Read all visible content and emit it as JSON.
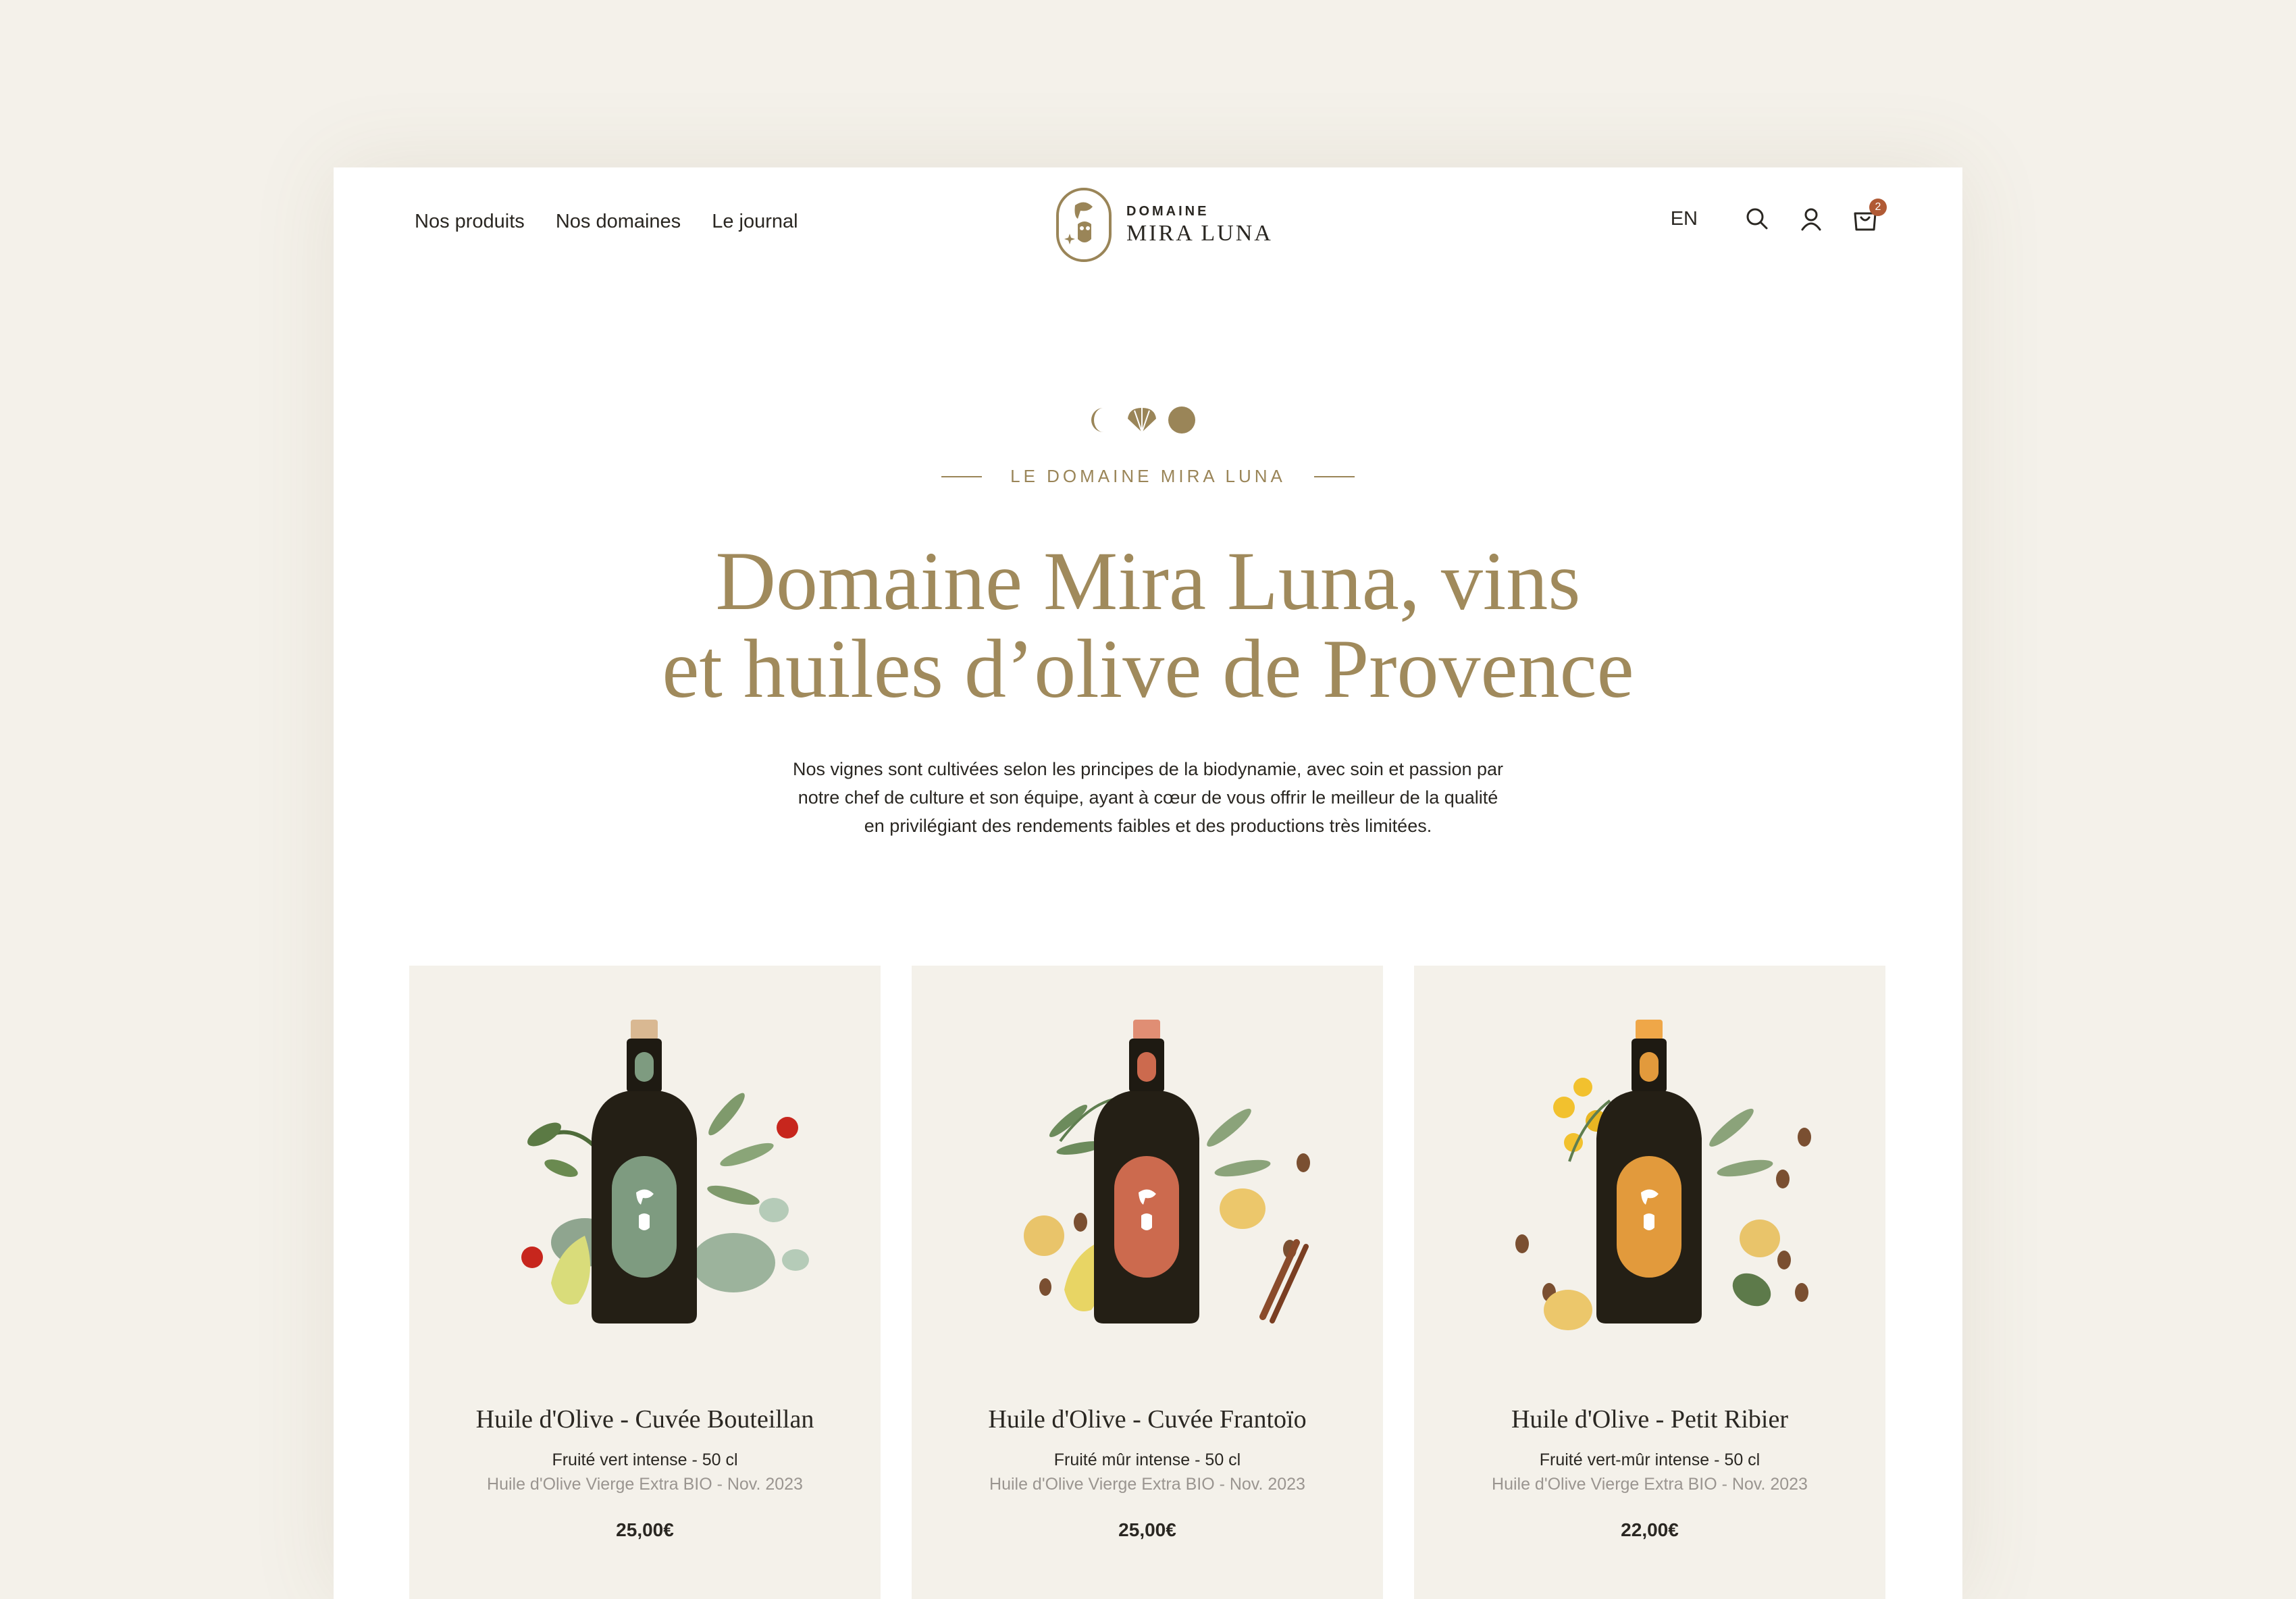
{
  "nav": {
    "items": [
      {
        "label": "Nos produits"
      },
      {
        "label": "Nos domaines"
      },
      {
        "label": "Le journal"
      }
    ]
  },
  "logo": {
    "top": "DOMAINE",
    "bottom": "MIRA LUNA"
  },
  "header": {
    "lang": "EN",
    "cart_count": "2"
  },
  "hero": {
    "eyebrow": "LE DOMAINE MIRA LUNA",
    "title_line1": "Domaine Mira Luna, vins",
    "title_line2": "et huiles d’olive de Provence",
    "description_lines": [
      "Nos vignes sont cultivées selon les principes de la biodynamie, avec soin et passion par",
      "notre chef de culture et son équipe, ayant à cœur de vous offrir le meilleur de la qualité",
      "en privilégiant des rendements faibles et des productions très limitées."
    ]
  },
  "colors": {
    "gold": "#a08a5c",
    "background": "#f4f1ea",
    "text": "#2a2722",
    "muted": "#9a9590",
    "badge": "#b05a35",
    "label_green": "#7e9b80",
    "label_red": "#cc6a4e",
    "label_orange": "#e29a3c"
  },
  "products": [
    {
      "name": "Huile d'Olive - Cuvée Bouteillan",
      "taste": "Fruité vert intense - 50 cl",
      "subtitle": "Huile d'Olive Vierge Extra BIO - Nov. 2023",
      "price": "25,00€",
      "label_color": "#7e9b80"
    },
    {
      "name": "Huile d'Olive - Cuvée Frantoïo",
      "taste": "Fruité mûr intense - 50 cl",
      "subtitle": "Huile d'Olive Vierge Extra BIO - Nov. 2023",
      "price": "25,00€",
      "label_color": "#cc6a4e"
    },
    {
      "name": "Huile d'Olive - Petit Ribier",
      "taste": "Fruité vert-mûr intense - 50 cl",
      "subtitle": "Huile d'Olive Vierge Extra BIO - Nov. 2023",
      "price": "22,00€",
      "label_color": "#e29a3c"
    }
  ]
}
